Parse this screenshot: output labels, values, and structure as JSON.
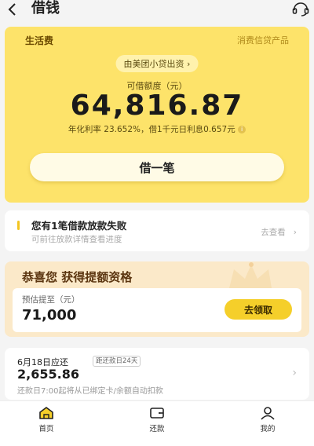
{
  "header": {
    "back_icon": "back-chevron-icon",
    "title": "借钱",
    "service_icon": "customer-service-icon"
  },
  "hero": {
    "tag": "生活费",
    "product_type": "消费信贷产品",
    "provider": "由美团小贷出资",
    "quota_label": "可借额度（元）",
    "quota_amount": "64,816.87",
    "rate_text": "年化利率  23.652%，借1千元日利息0.657元",
    "borrow_button": "借一笔",
    "colors": {
      "card": "#fde36a",
      "accent": "#f5cf2a"
    }
  },
  "notice": {
    "title": "您有1笔借款放款失败",
    "subtitle": "可前往放款详情查看进度",
    "link": "去查看"
  },
  "promo": {
    "title": "恭喜您 获得提额资格",
    "estimate_label": "预估提至（元）",
    "estimate_value": "71,000",
    "claim_button": "去领取"
  },
  "repay": {
    "due_date": "6月18日应还",
    "days_badge": "距还款日24天",
    "amount": "2,655.86",
    "note": "还款日7:00起将从已绑定卡/余额自动扣款"
  },
  "tabbar": {
    "items": [
      {
        "label": "首页",
        "icon": "home-icon",
        "active": true
      },
      {
        "label": "还款",
        "icon": "wallet-icon",
        "active": false
      },
      {
        "label": "我的",
        "icon": "user-icon",
        "active": false
      }
    ]
  }
}
